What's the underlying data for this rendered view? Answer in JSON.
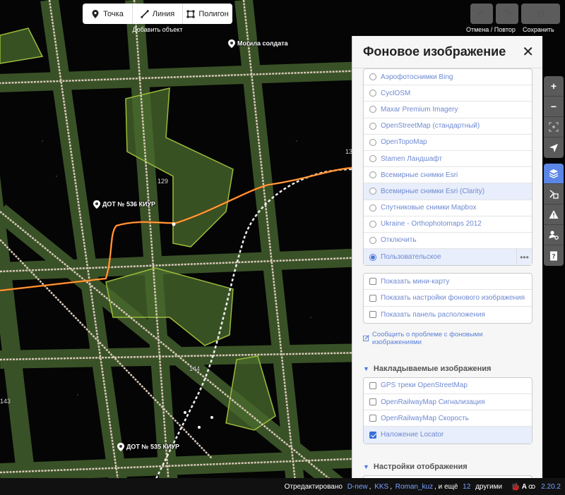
{
  "toolbar": {
    "modes": [
      {
        "label": "Точка",
        "icon": "point-icon"
      },
      {
        "label": "Линия",
        "icon": "line-icon"
      },
      {
        "label": "Полигон",
        "icon": "polygon-icon"
      }
    ],
    "add_feature_label": "Добавить объект",
    "undo_redo_label": "Отмена / Повтор",
    "save_label": "Сохранить"
  },
  "map": {
    "labels": [
      {
        "text": "Могила солдата",
        "icon": "memorial-pin-icon"
      },
      {
        "text": "ДОТ № 536 КИУР",
        "icon": "bunker-pin-icon"
      },
      {
        "text": "ДОТ № 535 КИУР",
        "icon": "bunker-pin-icon"
      }
    ],
    "elevations": [
      "129",
      "144",
      "143",
      "13"
    ]
  },
  "panel": {
    "title": "Фоновое изображение",
    "backgrounds": [
      {
        "label": "Аэрофотоснимки Bing",
        "selected": false,
        "highlight": false
      },
      {
        "label": "CyclOSM",
        "selected": false,
        "highlight": false
      },
      {
        "label": "Maxar Premium Imagery",
        "selected": false,
        "highlight": false
      },
      {
        "label": "OpenStreetMap (стандартный)",
        "selected": false,
        "highlight": false
      },
      {
        "label": "OpenTopoMap",
        "selected": false,
        "highlight": false
      },
      {
        "label": "Stamen Ландшафт",
        "selected": false,
        "highlight": false
      },
      {
        "label": "Всемирные снимки Esri",
        "selected": false,
        "highlight": false
      },
      {
        "label": "Всемирные снимки Esri (Clarity)",
        "selected": false,
        "highlight": true
      },
      {
        "label": "Спутниковые снимки Mapbox",
        "selected": false,
        "highlight": false
      },
      {
        "label": "Ukraine - Orthophotomaps 2012",
        "selected": false,
        "highlight": false
      },
      {
        "label": "Отключить",
        "selected": false,
        "highlight": false
      },
      {
        "label": "Пользовательское",
        "selected": true,
        "highlight": true
      }
    ],
    "display_options": [
      {
        "label": "Показать мини-карту",
        "checked": false
      },
      {
        "label": "Показать настройки фонового изображения",
        "checked": false
      },
      {
        "label": "Показать панель расположения",
        "checked": false
      }
    ],
    "report_link": "Сообщить о проблеме с фоновыми изображениями",
    "overlays_title": "Накладываемые изображения",
    "overlays": [
      {
        "label": "GPS треки OpenStreetMap",
        "checked": false,
        "highlight": false
      },
      {
        "label": "OpenRailwayMap Сигнализация",
        "checked": false,
        "highlight": false
      },
      {
        "label": "OpenRailwayMap Скорость",
        "checked": false,
        "highlight": false
      },
      {
        "label": "Наложение Locator",
        "checked": true,
        "highlight": true
      }
    ],
    "display_settings_title": "Настройки отображения"
  },
  "tools": {
    "map_controls": [
      {
        "icon": "zoom-in-icon",
        "glyph": "+"
      },
      {
        "icon": "zoom-out-icon",
        "glyph": "−"
      },
      {
        "icon": "zoom-to-selection-icon",
        "glyph": ""
      },
      {
        "icon": "geolocate-icon",
        "glyph": ""
      }
    ],
    "panes": [
      {
        "icon": "layers-icon",
        "active": true
      },
      {
        "icon": "map-data-icon",
        "active": false
      },
      {
        "icon": "issues-icon",
        "active": false
      },
      {
        "icon": "preferences-icon",
        "active": false
      },
      {
        "icon": "help-icon",
        "active": false
      }
    ]
  },
  "footer": {
    "prefix": "Отредактировано",
    "users": [
      "D-new",
      "KKS",
      "Roman_kuz"
    ],
    "suffix_a": ", и ещё",
    "count": "12",
    "suffix_b": "другими",
    "version": "2.20.2"
  },
  "colors": {
    "accent": "#5b86e5",
    "link": "#6f8ad1",
    "overlay_fill": "#4a6b2e",
    "road": "#d8c8b8",
    "gps_track": "#ff6a00"
  }
}
